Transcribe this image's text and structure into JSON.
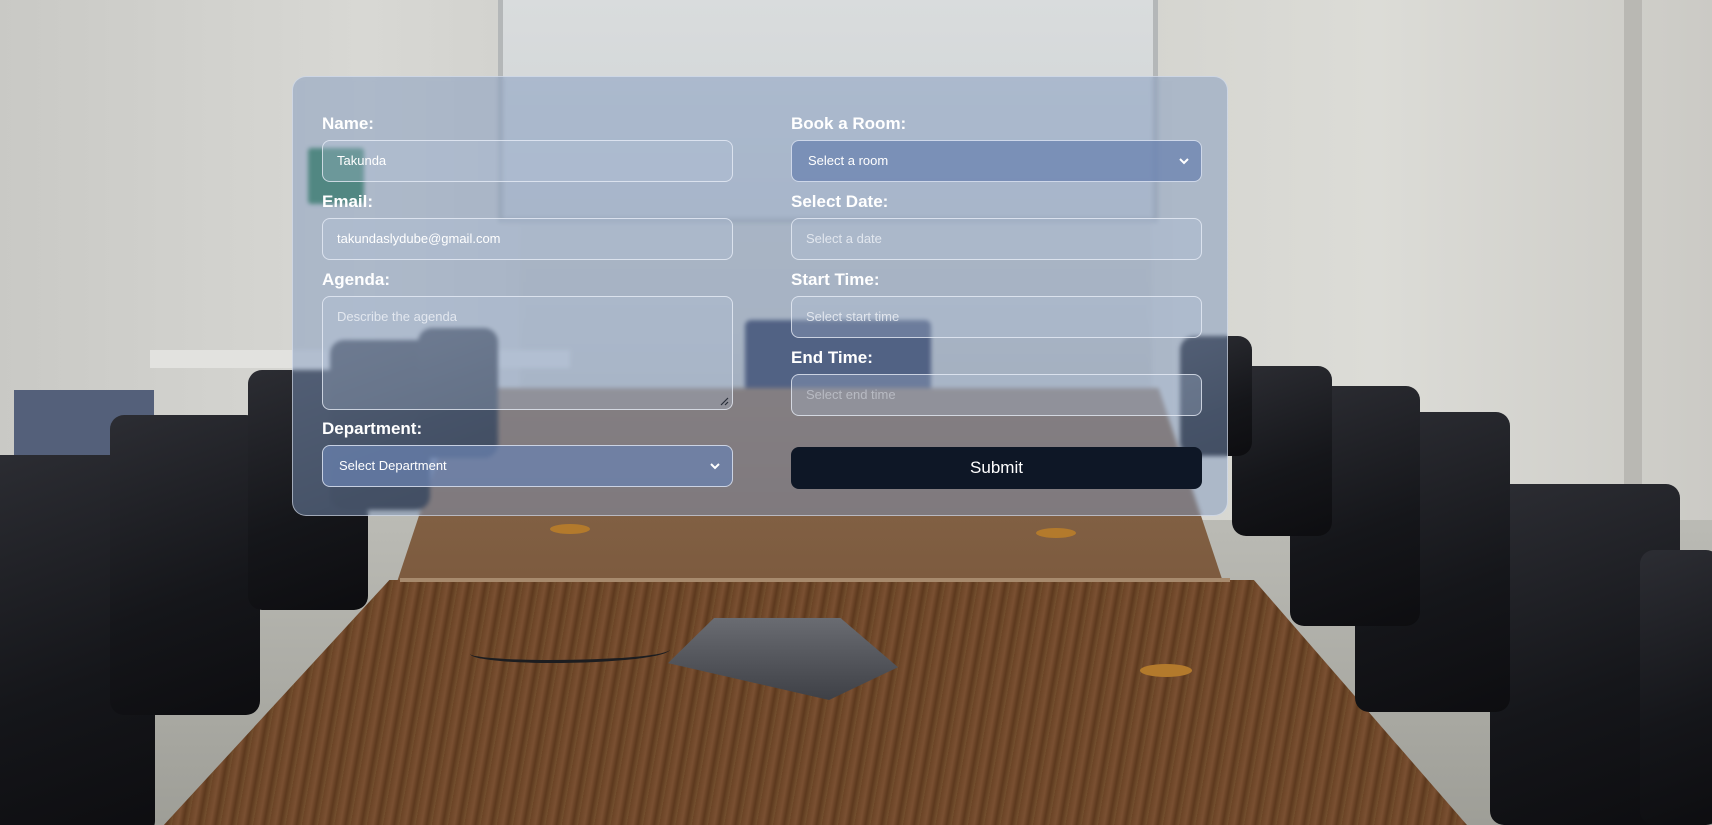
{
  "form": {
    "name": {
      "label": "Name:",
      "value": "Takunda"
    },
    "email": {
      "label": "Email:",
      "value": "takundaslydube@gmail.com"
    },
    "agenda": {
      "label": "Agenda:",
      "placeholder": "Describe the agenda"
    },
    "department": {
      "label": "Department:",
      "selected": "Select Department"
    },
    "room": {
      "label": "Book a Room:",
      "selected": "Select a room"
    },
    "date": {
      "label": "Select Date:",
      "placeholder": "Select a date"
    },
    "start_time": {
      "label": "Start Time:",
      "placeholder": "Select start time"
    },
    "end_time": {
      "label": "End Time:",
      "placeholder": "Select end time"
    },
    "submit_label": "Submit"
  },
  "colors": {
    "card_tint": "#7d96be",
    "select_bg": "#6982af",
    "submit_bg": "#0e1726",
    "label_text": "#ffffff"
  },
  "icons": {
    "select_arrow": "chevron-down-icon",
    "textarea_grip": "resize-handle-icon"
  }
}
